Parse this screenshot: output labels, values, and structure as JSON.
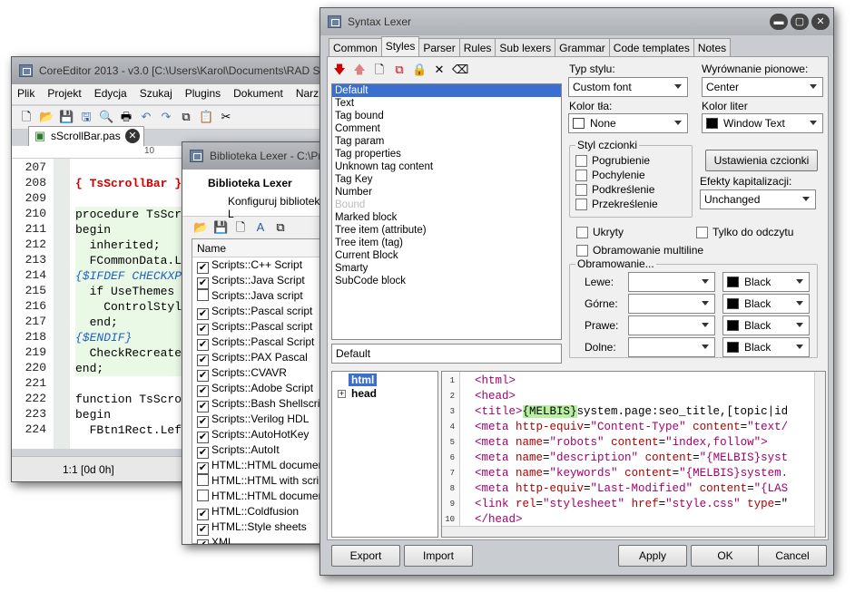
{
  "editor": {
    "title": "CoreEditor 2013 - v3.0 [C:\\Users\\Karol\\Documents\\RAD Stu",
    "menu": [
      "Plik",
      "Projekt",
      "Edycja",
      "Szukaj",
      "Plugins",
      "Dokument",
      "Narz"
    ],
    "tab": "sScrollBar.pas",
    "ruler": "10",
    "lines": [
      {
        "n": "207",
        "t": ""
      },
      {
        "n": "208",
        "t": "{ TsScrollBar }"
      },
      {
        "n": "209",
        "t": ""
      },
      {
        "n": "210",
        "t": "procedure TsScr"
      },
      {
        "n": "211",
        "t": "begin"
      },
      {
        "n": "212",
        "t": "  inherited;"
      },
      {
        "n": "213",
        "t": "  FCommonData.L"
      },
      {
        "n": "214",
        "t": "{$IFDEF CHECKXP"
      },
      {
        "n": "215",
        "t": "  if UseThemes"
      },
      {
        "n": "216",
        "t": "    ControlStyl"
      },
      {
        "n": "217",
        "t": "  end;"
      },
      {
        "n": "218",
        "t": "{$ENDIF}"
      },
      {
        "n": "219",
        "t": "  CheckRecreate"
      },
      {
        "n": "220",
        "t": "end;"
      },
      {
        "n": "221",
        "t": ""
      },
      {
        "n": "222",
        "t": "function TsScro"
      },
      {
        "n": "223",
        "t": "begin"
      },
      {
        "n": "224",
        "t": "  FBtn1Rect.Lef"
      }
    ],
    "status": "1:1 [0d 0h]"
  },
  "library": {
    "title": "Biblioteka Lexer - C:\\Pr",
    "header_title": "Biblioteka Lexer",
    "header_sub": "Konfiguruj bibliotekę L",
    "col": "Name",
    "items": [
      {
        "name": "Scripts::C++ Script",
        "checked": "✔"
      },
      {
        "name": "Scripts::Java Script",
        "checked": "✔"
      },
      {
        "name": "Scripts::Java script",
        "checked": ""
      },
      {
        "name": "Scripts::Pascal script",
        "checked": "✔"
      },
      {
        "name": "Scripts::Pascal script",
        "checked": "✔"
      },
      {
        "name": "Scripts::Pascal Script",
        "checked": "✔"
      },
      {
        "name": "Scripts::PAX Pascal",
        "checked": "✔"
      },
      {
        "name": "Scripts::CVAVR",
        "checked": "✔"
      },
      {
        "name": "Scripts::Adobe Script",
        "checked": "✔"
      },
      {
        "name": "Scripts::Bash Shellscript",
        "checked": "✔"
      },
      {
        "name": "Scripts::Verilog HDL",
        "checked": "✔"
      },
      {
        "name": "Scripts::AutoHotKey",
        "checked": "✔"
      },
      {
        "name": "Scripts::AutoIt",
        "checked": "✔"
      },
      {
        "name": "HTML::HTML documents",
        "checked": "✔"
      },
      {
        "name": "HTML::HTML with scripts",
        "checked": ""
      },
      {
        "name": "HTML::HTML documents",
        "checked": ""
      },
      {
        "name": "HTML::Coldfusion",
        "checked": "✔"
      },
      {
        "name": "HTML::Style sheets",
        "checked": "✔"
      },
      {
        "name": "XML",
        "checked": "✔"
      }
    ]
  },
  "dialog": {
    "title": "Syntax Lexer",
    "tabs": [
      "Common",
      "Styles",
      "Parser",
      "Rules",
      "Sub lexers",
      "Grammar",
      "Code templates",
      "Notes"
    ],
    "styles": [
      "Default",
      "Text",
      "Tag bound",
      "Comment",
      "Tag param",
      "Tag properties",
      "Unknown tag content",
      "Tag Key",
      "Number",
      "Bound",
      "Marked block",
      "Tree item (attribute)",
      "Tree item (tag)",
      "Current Block",
      "Smarty",
      "SubCode block"
    ],
    "style_name": "Default",
    "typ_stylu_label": "Typ stylu:",
    "typ_stylu": "Custom font",
    "wyrownanie_label": "Wyrównanie pionowe:",
    "wyrownanie": "Center",
    "kolor_tla_label": "Kolor tła:",
    "kolor_tla": "None",
    "kolor_liter_label": "Kolor liter",
    "kolor_liter": "Window Text",
    "styl_czcionki": "Styl czcionki",
    "font_styles": [
      "Pogrubienie",
      "Pochylenie",
      "Podkreślenie",
      "Przekreślenie"
    ],
    "font_button": "Ustawienia czcionki",
    "efekty_label": "Efekty kapitalizacji:",
    "efekty": "Unchanged",
    "ukryty": "Ukryty",
    "tylko": "Tylko do odczytu",
    "multiline": "Obramowanie multiline",
    "obramowanie": "Obramowanie...",
    "borders": [
      {
        "label": "Lewe:",
        "color": "Black"
      },
      {
        "label": "Górne:",
        "color": "Black"
      },
      {
        "label": "Prawe:",
        "color": "Black"
      },
      {
        "label": "Dolne:",
        "color": "Black"
      }
    ],
    "tree": [
      "html",
      "head"
    ],
    "code": [
      {
        "n": "1",
        "parts": [
          [
            "tag",
            "<html>"
          ]
        ]
      },
      {
        "n": "2",
        "parts": [
          [
            "tag",
            "<head>"
          ]
        ]
      },
      {
        "n": "3",
        "parts": [
          [
            "tag",
            "<title>"
          ],
          [
            "hl",
            "{MELBIS}"
          ],
          [
            "",
            "system.page:seo_title,[topic|id"
          ]
        ]
      },
      {
        "n": "4",
        "parts": [
          [
            "tag",
            "<meta "
          ],
          [
            "attr",
            "http-equiv"
          ],
          [
            "",
            "="
          ],
          [
            "val",
            "\"Content-Type\""
          ],
          [
            "attr",
            " content"
          ],
          [
            "",
            "="
          ],
          [
            "val",
            "\"text/"
          ]
        ]
      },
      {
        "n": "5",
        "parts": [
          [
            "tag",
            "<meta "
          ],
          [
            "attr",
            "name"
          ],
          [
            "",
            "="
          ],
          [
            "val",
            "\"robots\""
          ],
          [
            "attr",
            " content"
          ],
          [
            "",
            "="
          ],
          [
            "val",
            "\"index,follow\""
          ],
          [
            "tag",
            ">"
          ]
        ]
      },
      {
        "n": "6",
        "parts": [
          [
            "tag",
            "<meta "
          ],
          [
            "attr",
            "name"
          ],
          [
            "",
            "="
          ],
          [
            "val",
            "\"description\""
          ],
          [
            "attr",
            " content"
          ],
          [
            "",
            "="
          ],
          [
            "val",
            "\"{MELBIS}syst"
          ]
        ]
      },
      {
        "n": "7",
        "parts": [
          [
            "tag",
            "<meta "
          ],
          [
            "attr",
            "name"
          ],
          [
            "",
            "="
          ],
          [
            "val",
            "\"keywords\""
          ],
          [
            "attr",
            " content"
          ],
          [
            "",
            "="
          ],
          [
            "val",
            "\"{MELBIS}system."
          ]
        ]
      },
      {
        "n": "8",
        "parts": [
          [
            "tag",
            "<meta "
          ],
          [
            "attr",
            "http-equiv"
          ],
          [
            "",
            "="
          ],
          [
            "val",
            "\"Last-Modified\""
          ],
          [
            "attr",
            " content"
          ],
          [
            "",
            "="
          ],
          [
            "val",
            "\"{LAS"
          ]
        ]
      },
      {
        "n": "9",
        "parts": [
          [
            "tag",
            "<link "
          ],
          [
            "attr",
            "rel"
          ],
          [
            "",
            "="
          ],
          [
            "val",
            "\"stylesheet\""
          ],
          [
            "attr",
            " href"
          ],
          [
            "",
            "="
          ],
          [
            "val",
            "\"style.css\""
          ],
          [
            "attr",
            " type"
          ],
          [
            "",
            "=\""
          ]
        ]
      },
      {
        "n": "10",
        "parts": [
          [
            "tag",
            "</head>"
          ]
        ]
      }
    ],
    "buttons": {
      "export": "Export",
      "import": "Import",
      "apply": "Apply",
      "ok": "OK",
      "cancel": "Cancel"
    }
  }
}
